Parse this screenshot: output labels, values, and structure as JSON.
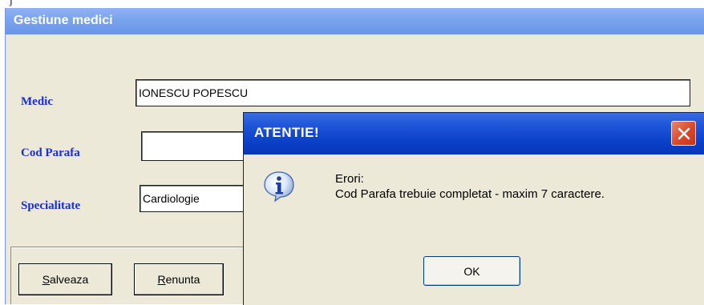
{
  "window": {
    "title": "Gestiune medici"
  },
  "form": {
    "medic_label": "Medic",
    "medic_value": "IONESCU POPESCU",
    "cod_parafa_label": "Cod Parafa",
    "cod_parafa_value": "",
    "specialitate_label": "Specialitate",
    "specialitate_value": "Cardiologie"
  },
  "buttons": {
    "save_mnemonic": "S",
    "save_rest": "alveaza",
    "cancel_mnemonic": "R",
    "cancel_rest": "enunta"
  },
  "dialog": {
    "title": "ATENTIE!",
    "line1": "Erori:",
    "line2": "Cod Parafa trebuie completat - maxim 7 caractere.",
    "ok_label": "OK",
    "icon": "info-icon"
  },
  "colors": {
    "label_blue": "#1730d0",
    "dialog_title_blue": "#0a3fc8",
    "close_red": "#d9472a"
  }
}
